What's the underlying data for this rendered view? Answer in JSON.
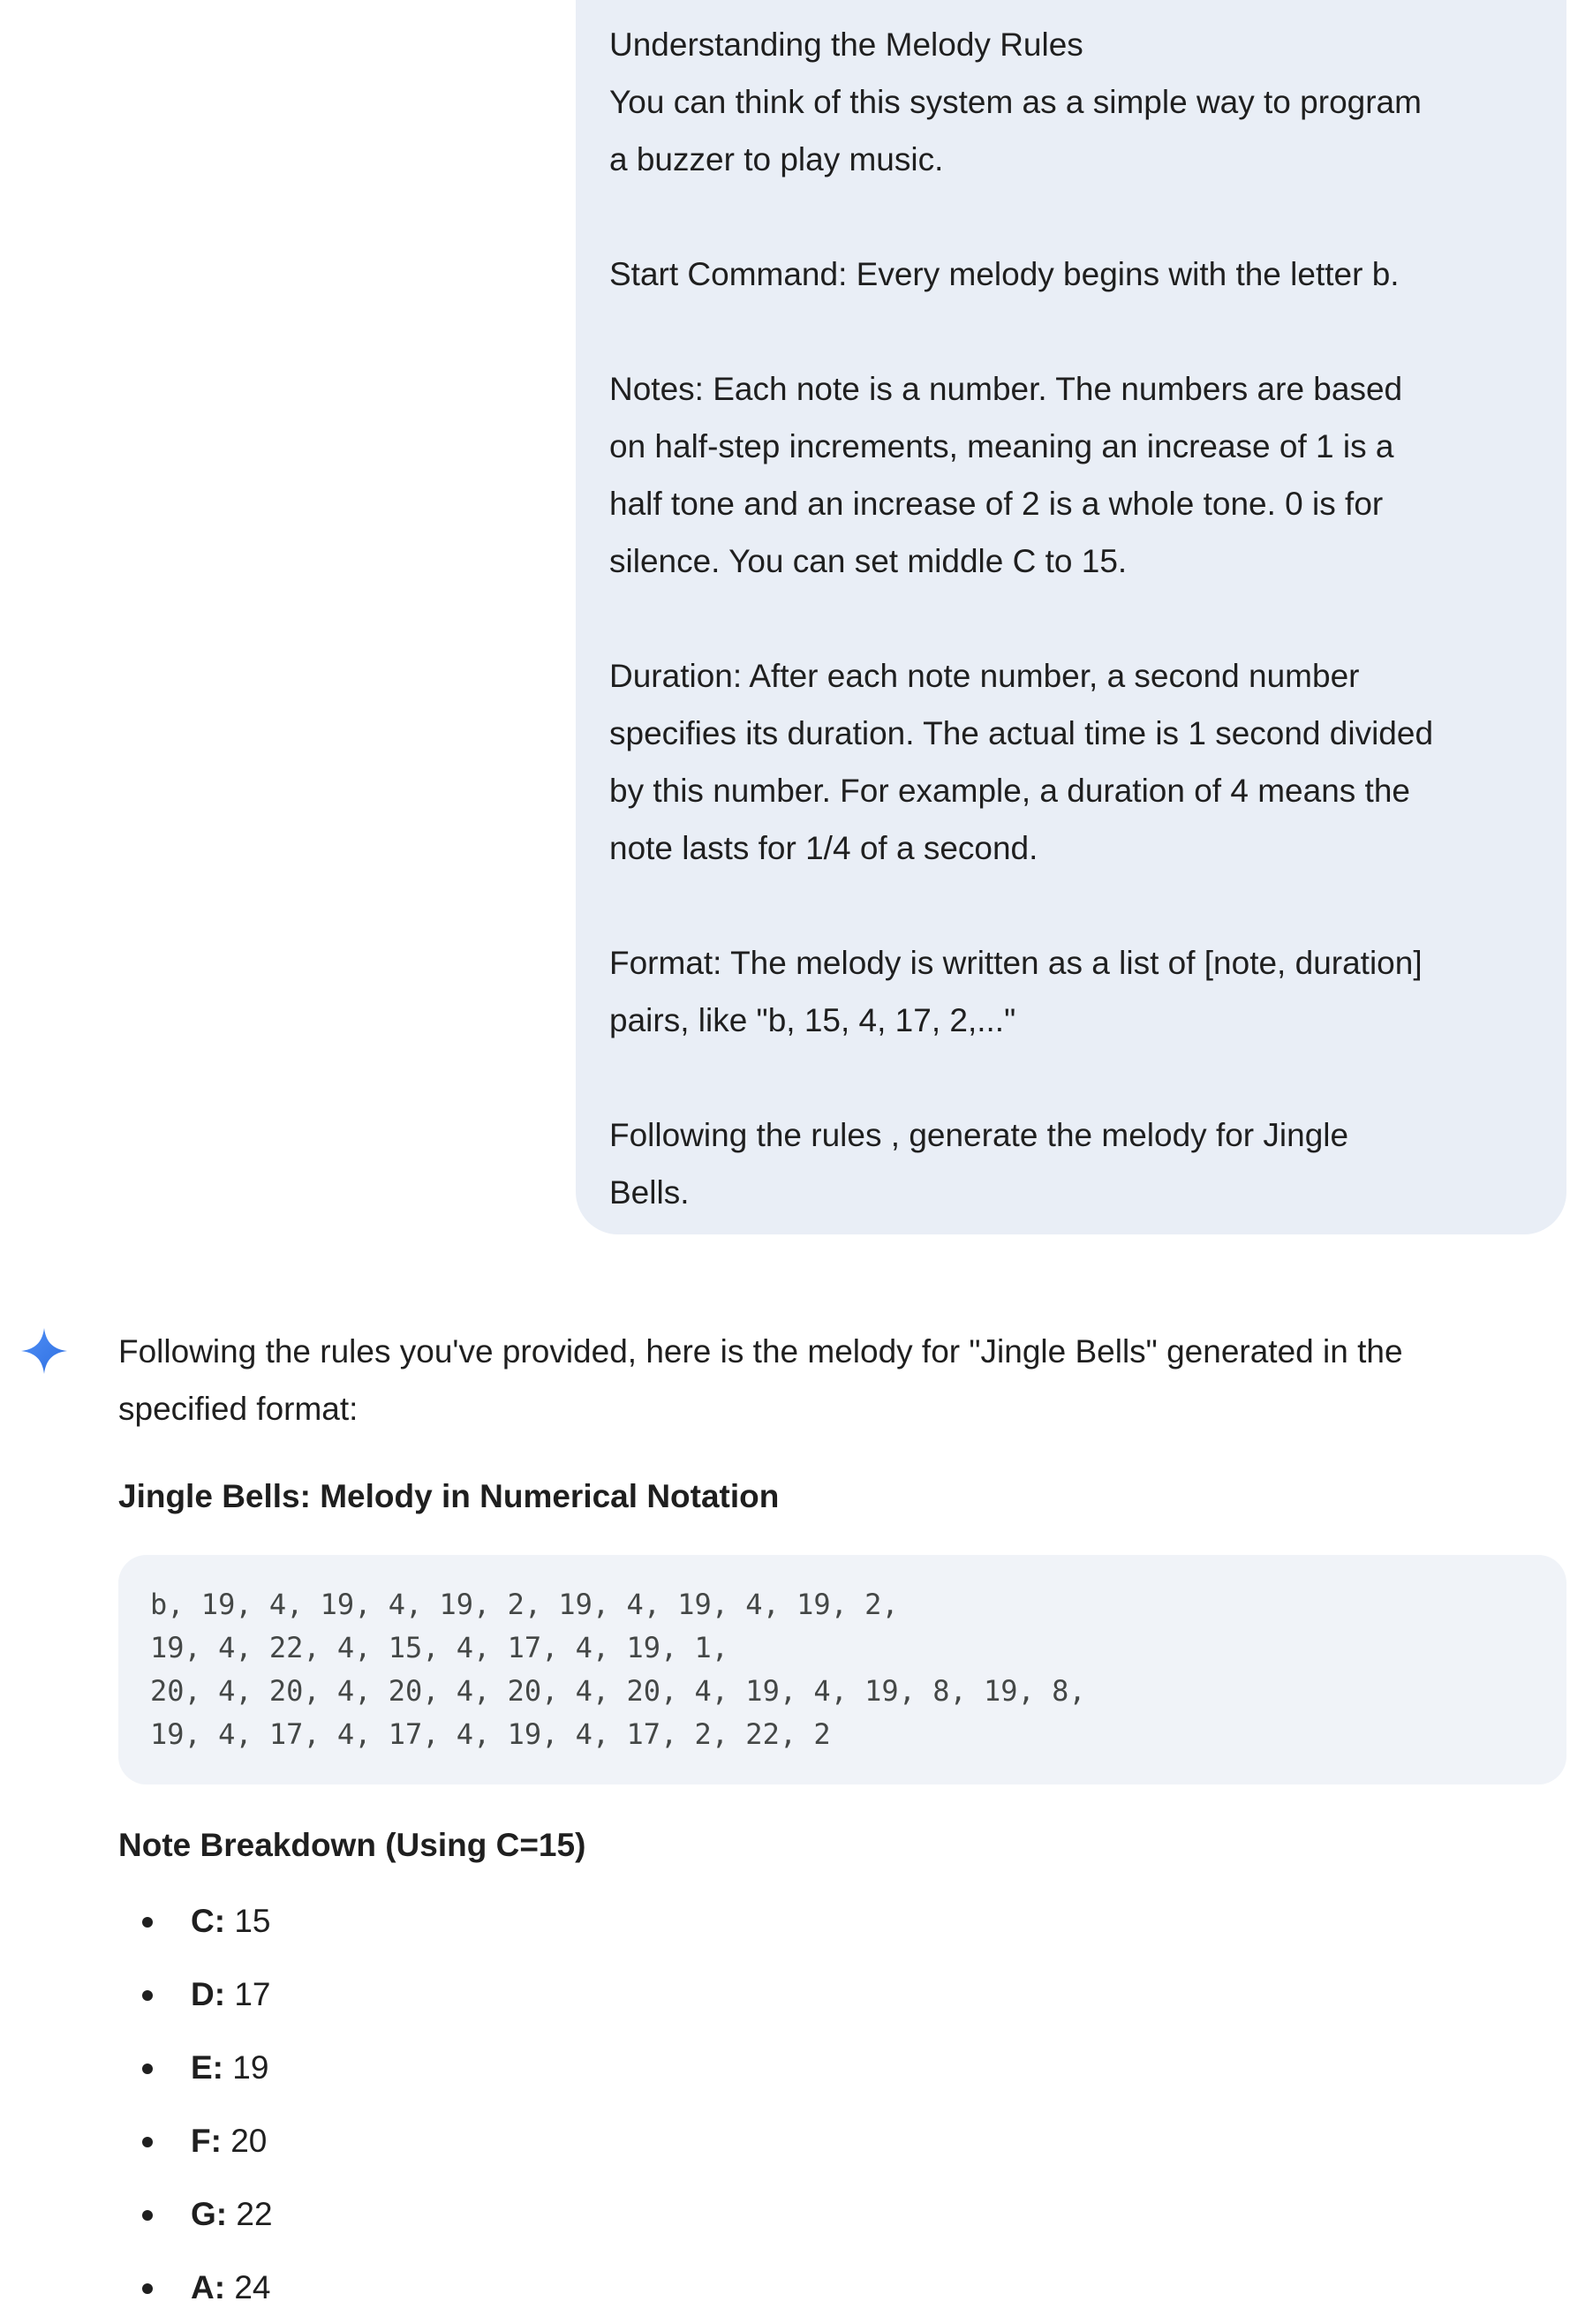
{
  "user_message": {
    "lines": [
      "Understanding the Melody Rules",
      "You can think of this system as a simple way to program",
      "a buzzer to play music."
    ],
    "paragraphs": [
      [
        "Start Command: Every melody begins with the letter b."
      ],
      [
        "Notes: Each note is a number. The numbers are based",
        "on half-step increments, meaning an increase of 1 is a",
        "half tone and an increase of 2 is a whole tone. 0 is for",
        "silence. You can set middle C to 15."
      ],
      [
        "Duration: After each note number, a second number",
        "specifies its duration. The actual time is 1 second divided",
        "by this number. For example, a duration of 4 means the",
        "note lasts for 1/4 of a second."
      ],
      [
        "Format: The melody is written as a list of [note, duration]",
        "pairs, like \"b, 15, 4, 17, 2,...\""
      ],
      [
        "Following the rules , generate the melody for Jingle",
        "Bells."
      ]
    ]
  },
  "response": {
    "intro_line1": "Following the rules you've provided, here is the melody for \"Jingle Bells\" generated in the",
    "intro_line2": "specified format:",
    "heading": "Jingle Bells: Melody in Numerical Notation",
    "code_lines": [
      "b, 19, 4, 19, 4, 19, 2, 19, 4, 19, 4, 19, 2,",
      "19, 4, 22, 4, 15, 4, 17, 4, 19, 1,",
      "20, 4, 20, 4, 20, 4, 20, 4, 20, 4, 19, 4, 19, 8, 19, 8,",
      "19, 4, 17, 4, 17, 4, 19, 4, 17, 2, 22, 2"
    ],
    "breakdown_title": "Note Breakdown (Using C=15)",
    "notes": [
      {
        "label": "C:",
        "value": " 15"
      },
      {
        "label": "D:",
        "value": " 17"
      },
      {
        "label": "E:",
        "value": " 19"
      },
      {
        "label": "F:",
        "value": " 20"
      },
      {
        "label": "G:",
        "value": " 22"
      },
      {
        "label": "A:",
        "value": " 24"
      }
    ]
  },
  "colors": {
    "user_bubble_bg": "#e9eef6",
    "code_bg": "#f0f3f8",
    "sparkle_blue": "#4285f4"
  },
  "icons": {
    "assistant": "sparkle-icon"
  }
}
